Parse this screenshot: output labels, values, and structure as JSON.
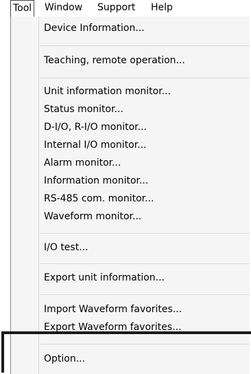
{
  "menubar": {
    "items": [
      "Tool",
      "Window",
      "Support",
      "Help"
    ]
  },
  "menu": {
    "items": [
      "Device Information...",
      "Teaching, remote operation...",
      "Unit information monitor...",
      "Status monitor...",
      "D-I/O, R-I/O monitor...",
      "Internal I/O monitor...",
      "Alarm monitor...",
      "Information monitor...",
      "RS-485 com. monitor...",
      "Waveform monitor...",
      "I/O test...",
      "Export unit information...",
      "Import  Waveform favorites...",
      "Export Waveform favorites...",
      "Option..."
    ]
  },
  "colors": {
    "menu_background": "#f5f5f5",
    "separator": "#d8d8d8",
    "highlight_border": "#1a1a1a"
  }
}
